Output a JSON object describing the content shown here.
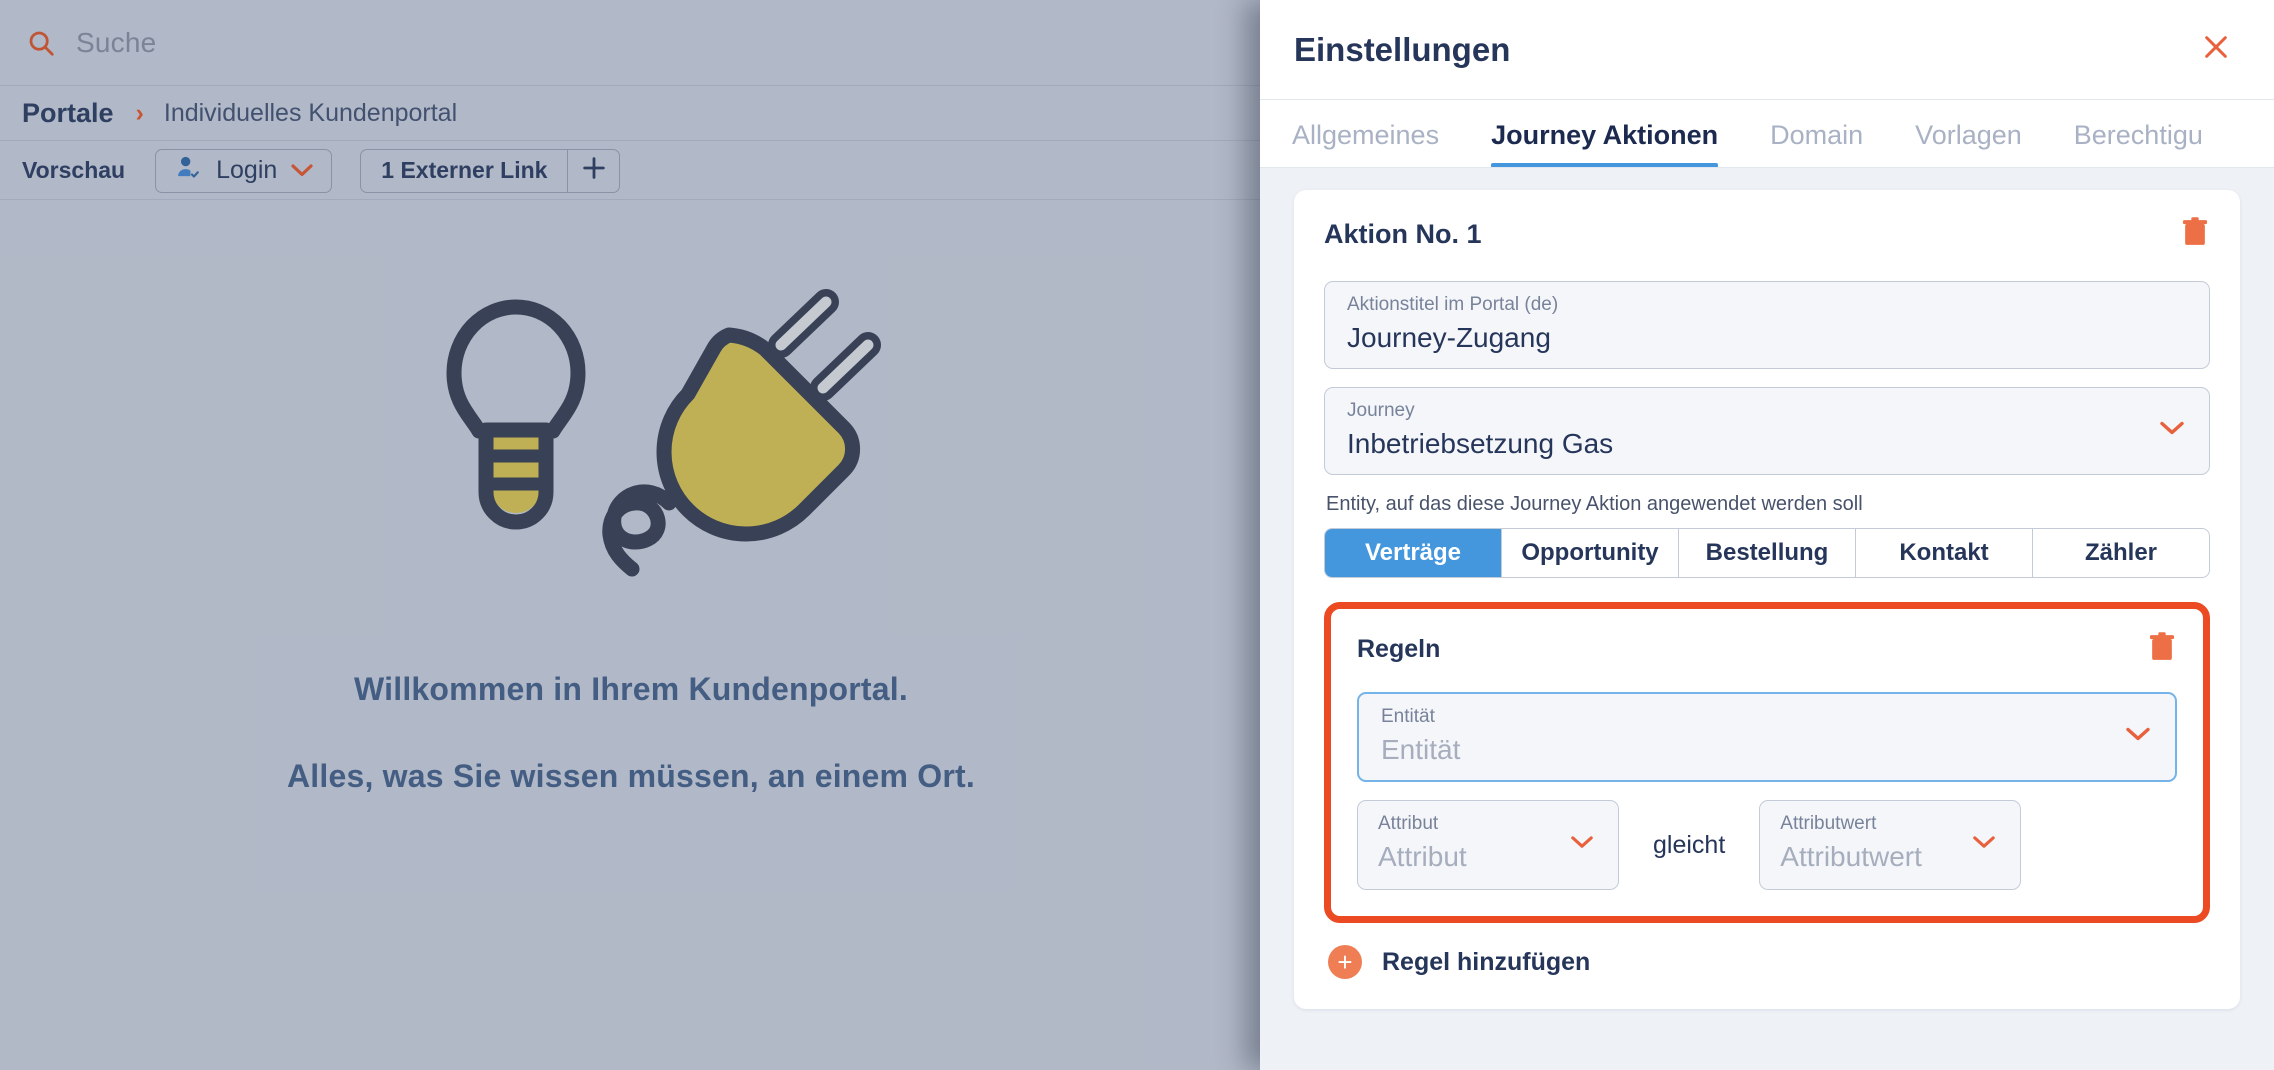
{
  "background_app": {
    "search": {
      "placeholder": "Suche",
      "icon": "search-icon"
    },
    "breadcrumb": {
      "root": "Portale",
      "separator": "›",
      "leaf": "Individuelles Kundenportal"
    },
    "toolbar": {
      "preview_label": "Vorschau",
      "login_label": "Login",
      "login_icon": "user-check-icon",
      "login_chevron_icon": "chevron-down-icon",
      "external_link_label": "1 Externer Link",
      "add_label": "+",
      "add_icon": "plus-icon"
    },
    "hero": {
      "illustration": "lightbulb-and-plug-illustration",
      "title": "Willkommen in Ihrem Kundenportal.",
      "subtitle": "Alles, was Sie wissen müssen, an einem Ort."
    }
  },
  "panel": {
    "title": "Einstellungen",
    "close_icon": "close-icon",
    "tabs": [
      {
        "label": "Allgemeines",
        "active": false
      },
      {
        "label": "Journey Aktionen",
        "active": true
      },
      {
        "label": "Domain",
        "active": false
      },
      {
        "label": "Vorlagen",
        "active": false
      },
      {
        "label": "Berechtigu",
        "active": false
      }
    ],
    "action_card": {
      "title": "Aktion No. 1",
      "delete_icon": "trash-icon",
      "action_title_field": {
        "label": "Aktionstitel im Portal (de)",
        "value": "Journey-Zugang"
      },
      "journey_field": {
        "label": "Journey",
        "value": "Inbetriebsetzung Gas",
        "chevron_icon": "chevron-down-icon"
      },
      "entity_hint": "Entity, auf das diese Journey Aktion angewendet werden soll",
      "entity_options": [
        {
          "label": "Verträge",
          "selected": true
        },
        {
          "label": "Opportunity",
          "selected": false
        },
        {
          "label": "Bestellung",
          "selected": false
        },
        {
          "label": "Kontakt",
          "selected": false
        },
        {
          "label": "Zähler",
          "selected": false
        }
      ],
      "rules": {
        "title": "Regeln",
        "delete_icon": "trash-icon",
        "entity_field": {
          "label": "Entität",
          "placeholder": "Entität",
          "chevron_icon": "chevron-down-icon"
        },
        "attribute_field": {
          "label": "Attribut",
          "placeholder": "Attribut",
          "chevron_icon": "chevron-down-icon"
        },
        "operator": "gleicht",
        "attribute_value_field": {
          "label": "Attributwert",
          "placeholder": "Attributwert",
          "chevron_icon": "chevron-down-icon"
        }
      },
      "add_rule": {
        "label": "Regel hinzufügen",
        "icon": "plus-circle-icon"
      }
    }
  },
  "colors": {
    "accent_orange": "#e8603c",
    "highlight_red": "#eb4a22",
    "accent_blue": "#4597dd",
    "panel_bg": "#eef1f6",
    "app_bg": "#b8bfcd",
    "text_dark": "#26365a",
    "bulb_yellow": "#c9b64e",
    "plug_dark": "#323a4f"
  }
}
